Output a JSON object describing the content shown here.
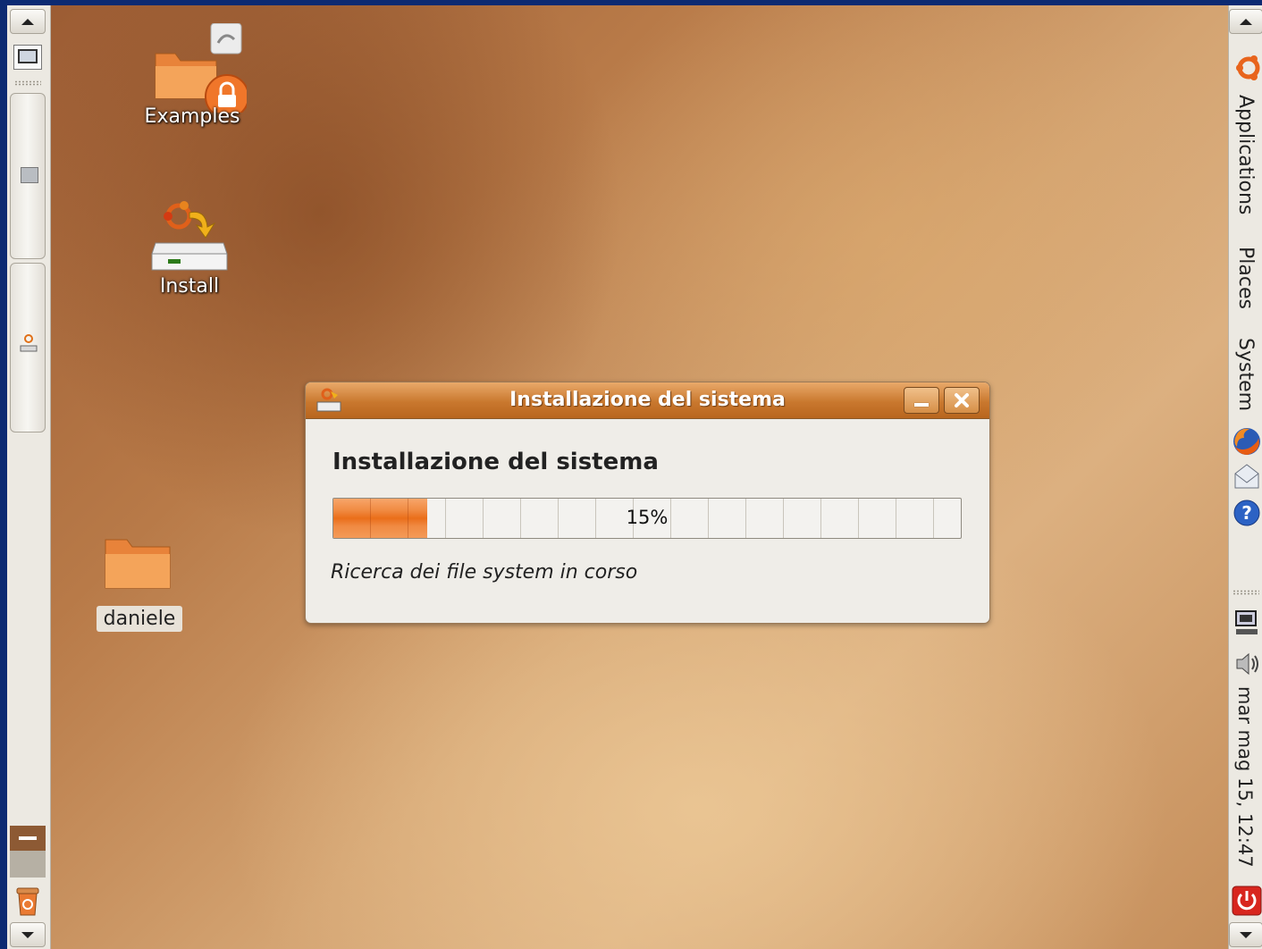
{
  "desktop": {
    "icons": [
      {
        "label": "Examples"
      },
      {
        "label": "Install"
      },
      {
        "label": "daniele"
      }
    ]
  },
  "top_panel": {
    "menus": [
      "Applications",
      "Places",
      "System"
    ],
    "clock": "mar mag 15, 12:47"
  },
  "dialog": {
    "window_title": "Installazione del sistema",
    "heading": "Installazione del sistema",
    "progress": {
      "percent": 15,
      "label": "15%"
    },
    "status": "Ricerca dei file system in corso"
  },
  "colors": {
    "accent": "#ea6e1a",
    "titlebar": "#c9782e",
    "panel": "#ece9e2",
    "frame": "#0c2a72"
  }
}
